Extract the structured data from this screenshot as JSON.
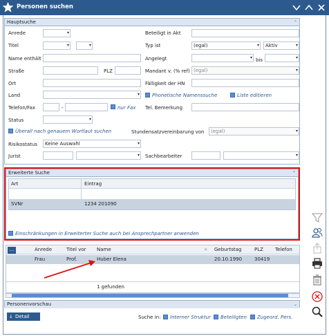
{
  "window": {
    "title": "Personen suchen"
  },
  "haupt": {
    "header": "Hauptsuche",
    "anrede": "Anrede",
    "titel": "Titel",
    "name_enthaelt": "Name enthält",
    "strasse": "Straße",
    "plz": "PLZ",
    "ort": "Ort",
    "land": "Land",
    "telefon_fax": "Telefon/Fax",
    "tel_sep": "-",
    "nur_fax": "nur Fax",
    "status": "Status",
    "ueberall": "Überall nach genauem Wortlaut suchen",
    "risikostatus": "Risikostatus",
    "risikostatus_value": "Keine Auswahl",
    "jurist": "Jurist",
    "beteiligt_in_akt": "Beteiligt in Akt",
    "typ_ist": "Typ ist",
    "typ_value": "(egal)",
    "aktiv_value": "Aktiv",
    "angelegt": "Angelegt",
    "bis": "bis",
    "mandant": "Mandant v. (% ref)",
    "mandant_value": "(egal)",
    "faelligkeit": "Fälligkeit der HN",
    "phonetische": "Phonetische Namenssuche",
    "liste_editieren": "Liste editieren",
    "tel_bemerkung": "Tel. Bemerkung",
    "stundensatz": "Stundensatzvereinbarung von",
    "stundensatz_value": "(egal)",
    "sachbearbeiter": "Sachbearbeiter"
  },
  "erweitert": {
    "header": "Erweiterte Suche",
    "col_art": "Art",
    "col_eintrag": "Eintrag",
    "row_art": "SVNr",
    "row_eintrag": "1234 201090",
    "einschraenkungen": "Einschränkungen in Erweiterter Suche auch bei Ansprechpartner anwenden"
  },
  "results": {
    "menu_btn": "...",
    "col_anrede": "Anrede",
    "col_titel": "Titel vor",
    "col_name": "Name",
    "col_geb": "Geburtstag",
    "col_plz": "PLZ",
    "col_tel": "Telefon",
    "sort_indicator": "▵",
    "rows": [
      {
        "anrede": "Frau",
        "titel": "Prof.",
        "name": "Huber Elena",
        "geb": "20.10.1990",
        "plz": "30419",
        "tel": ""
      }
    ],
    "found": "1 gefunden"
  },
  "vorschau": {
    "header": "Personenvorschau"
  },
  "footer": {
    "detail": "Detail",
    "suche_in": "Suche in:",
    "interner": "Interner Struktur",
    "beteiligten": "Beteiligten",
    "zugeord": "Zugeord. Pers."
  },
  "colors": {
    "accent": "#2d5a8e",
    "highlight": "#d11111",
    "selected_row": "#c8d3e0"
  }
}
